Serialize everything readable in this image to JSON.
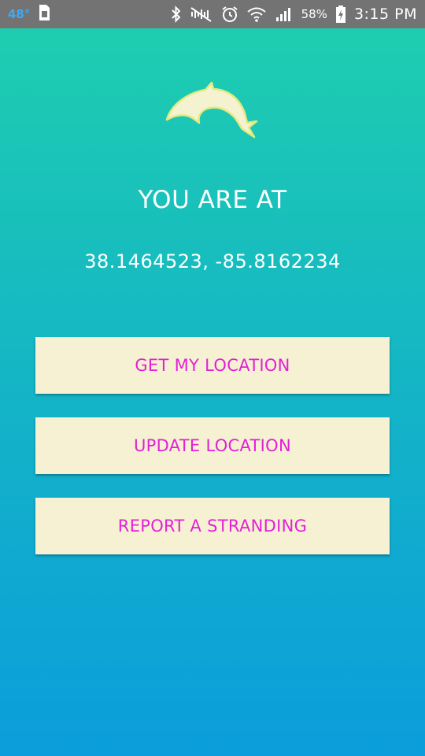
{
  "status_bar": {
    "temperature": "48°",
    "battery_percent": "58%",
    "time": "3:15 PM",
    "icons": [
      "sim-card-icon",
      "bluetooth-icon",
      "mute-icon",
      "alarm-icon",
      "wifi-icon",
      "signal-icon",
      "battery-charging-icon"
    ]
  },
  "main": {
    "logo_icon": "dolphin-icon",
    "headline": "YOU ARE AT",
    "coordinates": "38.1464523, -85.8162234"
  },
  "buttons": {
    "get_location": "GET MY LOCATION",
    "update_location": "UPDATE LOCATION",
    "report_stranding": "REPORT A STRANDING"
  },
  "colors": {
    "gradient_top": "#1fcfae",
    "gradient_bottom": "#0b9ddc",
    "button_background": "#f6f1d3",
    "button_text": "#e320d6",
    "status_bar": "#737373"
  }
}
